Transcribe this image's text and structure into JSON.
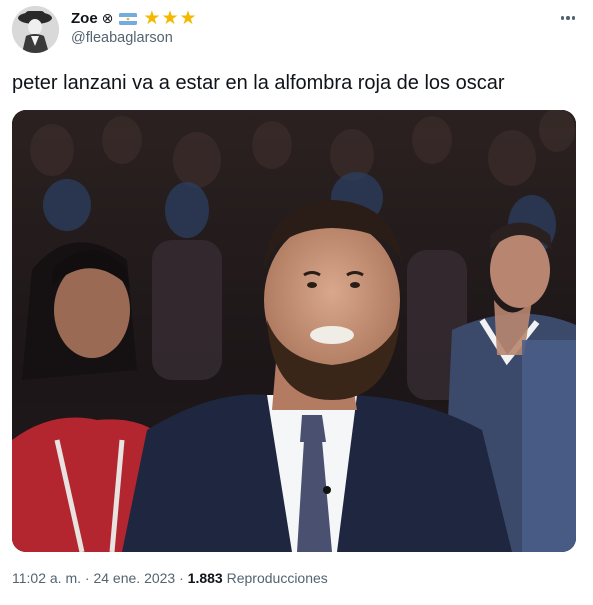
{
  "author": {
    "display_name": "Zoe",
    "name_symbol": "⊗",
    "flag_icon": "argentina-flag-icon",
    "stars": [
      "★",
      "★",
      "★"
    ],
    "star_color": "#f5b800",
    "handle": "@fleabaglarson"
  },
  "tweet": {
    "text": "peter lanzani va a estar en la alfombra roja de los oscar"
  },
  "meta": {
    "time": "11:02 a. m.",
    "separator": " · ",
    "date": "24 ene. 2023",
    "views_count": "1.883",
    "views_label": "Reproducciones"
  },
  "colors": {
    "text_primary": "#0f1419",
    "text_secondary": "#536471",
    "background": "#ffffff"
  }
}
